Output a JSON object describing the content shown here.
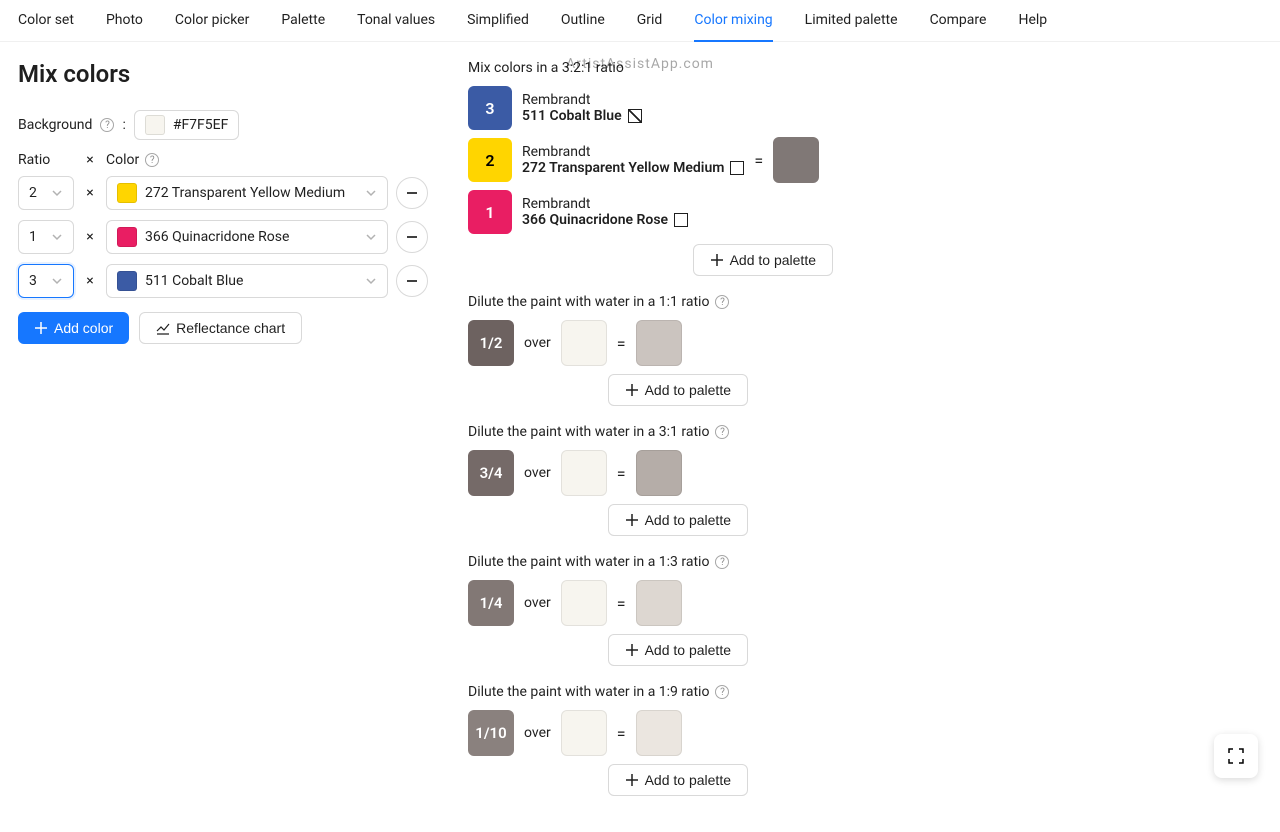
{
  "watermark": "ArtistAssistApp.com",
  "tabs": [
    "Color set",
    "Photo",
    "Color picker",
    "Palette",
    "Tonal values",
    "Simplified",
    "Outline",
    "Grid",
    "Color mixing",
    "Limited palette",
    "Compare",
    "Help"
  ],
  "activeTab": 8,
  "title": "Mix colors",
  "backgroundLabel": "Background",
  "backgroundValue": "#F7F5EF",
  "ratioHeader": "Ratio",
  "colorHeader": "Color",
  "times": "×",
  "mixRows": [
    {
      "ratio": "2",
      "swatch": "#FFD500",
      "name": "272 Transparent Yellow Medium",
      "focused": false
    },
    {
      "ratio": "1",
      "swatch": "#E91E63",
      "name": "366 Quinacridone Rose",
      "focused": false
    },
    {
      "ratio": "3",
      "swatch": "#3B5BA5",
      "name": "511 Cobalt Blue",
      "focused": true
    }
  ],
  "addColorLabel": "Add color",
  "reflectanceLabel": "Reflectance chart",
  "mixHeader": "Mix colors in a 3:2:1 ratio",
  "paints": [
    {
      "chip": "3",
      "chipBg": "#3B5BA5",
      "chipFg": "#fff",
      "brand": "Rembrandt",
      "name": "511 Cobalt Blue",
      "icon": "diag"
    },
    {
      "chip": "2",
      "chipBg": "#FFD500",
      "chipFg": "#000",
      "brand": "Rembrandt",
      "name": "272 Transparent Yellow Medium",
      "icon": "box"
    },
    {
      "chip": "1",
      "chipBg": "#E91E63",
      "chipFg": "#fff",
      "brand": "Rembrandt",
      "name": "366 Quinacridone Rose",
      "icon": "box"
    }
  ],
  "eq": "=",
  "resultColor": "#807876",
  "addPaletteLabel": "Add to palette",
  "dilutions": [
    {
      "header": "Dilute the paint with water in a 1:1 ratio",
      "frac": "1/2",
      "fracBg": "#6D6260",
      "fracFg": "#fff",
      "over": "over",
      "bg": "#F7F5EF",
      "result": "#CBC4BF"
    },
    {
      "header": "Dilute the paint with water in a 3:1 ratio",
      "frac": "3/4",
      "fracBg": "#756A68",
      "fracFg": "#fff",
      "over": "over",
      "bg": "#F7F5EF",
      "result": "#B5ADA8"
    },
    {
      "header": "Dilute the paint with water in a 1:3 ratio",
      "frac": "1/4",
      "fracBg": "#827875",
      "fracFg": "#fff",
      "over": "over",
      "bg": "#F7F5EF",
      "result": "#DDD7D1"
    },
    {
      "header": "Dilute the paint with water in a 1:9 ratio",
      "frac": "1/10",
      "fracBg": "#8A817E",
      "fracFg": "#fff",
      "over": "over",
      "bg": "#F7F5EF",
      "result": "#EBE6E0"
    }
  ]
}
